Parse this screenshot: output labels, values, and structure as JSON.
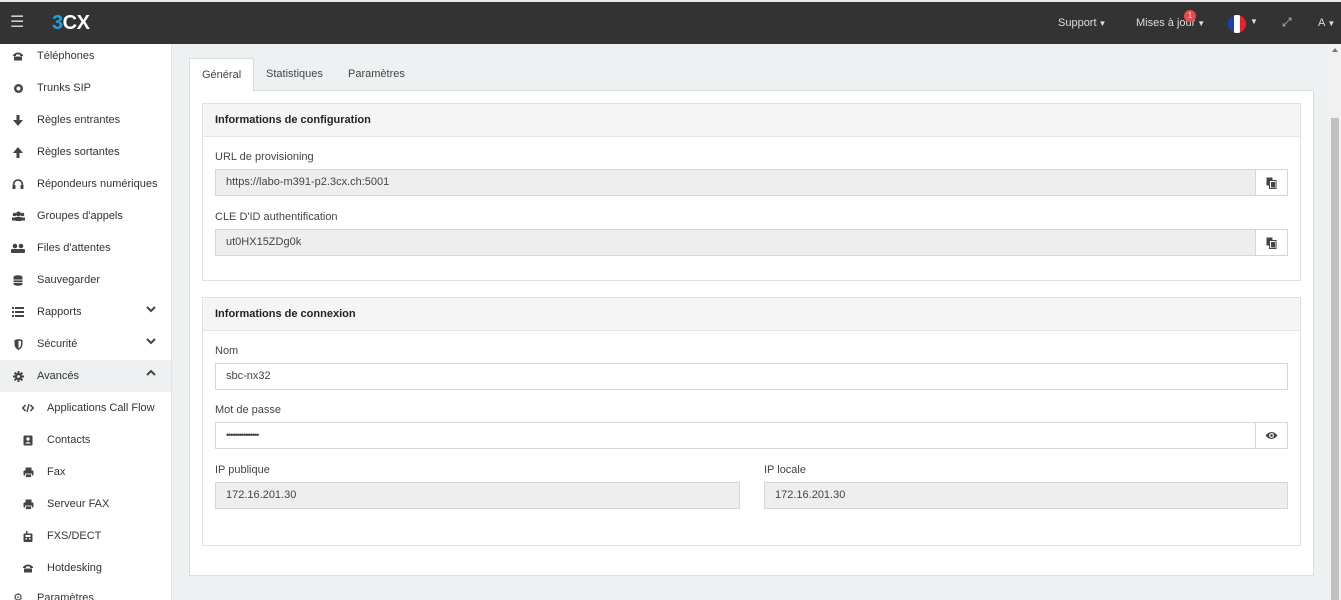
{
  "header": {
    "logo_prefix": "3",
    "logo_suffix": "CX",
    "menu_icon": "hamburger-icon",
    "support_label": "Support",
    "updates_label": "Mises à jour",
    "updates_badge": "1",
    "user_label": "A",
    "language_icon": "france-flag-icon",
    "fullscreen_icon": "expand-icon"
  },
  "sidebar": {
    "items": [
      {
        "label": "Téléphones",
        "icon": "phone-icon"
      },
      {
        "label": "Trunks SIP",
        "icon": "globe-icon"
      },
      {
        "label": "Règles entrantes",
        "icon": "arrow-down-icon"
      },
      {
        "label": "Règles sortantes",
        "icon": "arrow-up-icon"
      },
      {
        "label": "Répondeurs numériques",
        "icon": "headset-icon"
      },
      {
        "label": "Groupes d'appels",
        "icon": "users-icon"
      },
      {
        "label": "Files d'attentes",
        "icon": "group-icon"
      },
      {
        "label": "Sauvegarder",
        "icon": "database-icon"
      },
      {
        "label": "Rapports",
        "icon": "list-icon"
      },
      {
        "label": "Sécurité",
        "icon": "shield-icon"
      },
      {
        "label": "Avancés",
        "icon": "gear-icon"
      }
    ],
    "sub_items": [
      {
        "label": "Applications Call Flow",
        "icon": "code-icon"
      },
      {
        "label": "Contacts",
        "icon": "contact-book-icon"
      },
      {
        "label": "Fax",
        "icon": "fax-icon"
      },
      {
        "label": "Serveur FAX",
        "icon": "fax-server-icon"
      },
      {
        "label": "FXS/DECT",
        "icon": "dect-icon"
      },
      {
        "label": "Hotdesking",
        "icon": "desk-phone-icon"
      }
    ],
    "partial_item": {
      "label": "Paramètres",
      "icon": "wrench-icon"
    }
  },
  "tabs": [
    {
      "label": "Général"
    },
    {
      "label": "Statistiques"
    },
    {
      "label": "Paramètres"
    }
  ],
  "config_section": {
    "title": "Informations de configuration",
    "provisioning_label": "URL de provisioning",
    "provisioning_value": "https://labo-m391-p2.3cx.ch:5001",
    "auth_label": "CLE D'ID authentification",
    "auth_value": "ut0HX15ZDg0k",
    "copy_icon": "copy-icon"
  },
  "connection_section": {
    "title": "Informations de connexion",
    "name_label": "Nom",
    "name_value": "sbc-nx32",
    "password_label": "Mot de passe",
    "password_value": "•••••••••••••••",
    "show_password_icon": "eye-icon",
    "public_ip_label": "IP publique",
    "public_ip_value": "172.16.201.30",
    "local_ip_label": "IP locale",
    "local_ip_value": "172.16.201.30"
  }
}
